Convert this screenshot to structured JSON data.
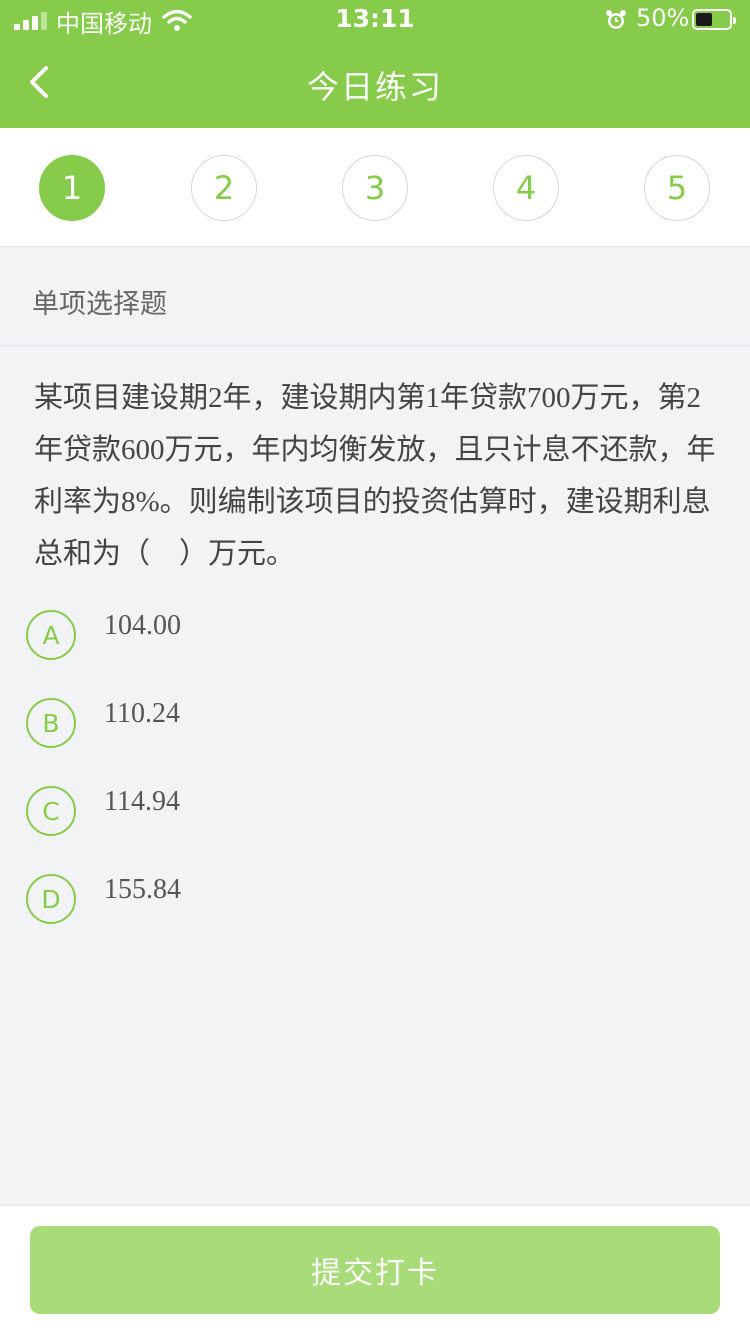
{
  "status_bar": {
    "carrier": "中国移动",
    "time": "13:11",
    "battery_percent_label": "50%",
    "battery_level": 0.5,
    "signal_bars": 3
  },
  "header": {
    "title": "今日练习",
    "back_icon": "chevron-left-icon"
  },
  "steps": [
    {
      "label": "1",
      "active": true
    },
    {
      "label": "2",
      "active": false
    },
    {
      "label": "3",
      "active": false
    },
    {
      "label": "4",
      "active": false
    },
    {
      "label": "5",
      "active": false
    }
  ],
  "question": {
    "type": "单项选择题",
    "text": "某项目建设期2年，建设期内第1年贷款700万元，第2年贷款600万元，年内均衡发放，且只计息不还款，年利率为8%。则编制该项目的投资估算时，建设期利息总和为（　）万元。",
    "options": [
      {
        "letter": "A",
        "text": "104.00"
      },
      {
        "letter": "B",
        "text": "110.24"
      },
      {
        "letter": "C",
        "text": "114.94"
      },
      {
        "letter": "D",
        "text": "155.84"
      }
    ]
  },
  "footer": {
    "submit_label": "提交打卡"
  },
  "colors": {
    "accent": "#86cc4a",
    "submit_disabled": "#a8dc78",
    "background": "#f2f3f5"
  }
}
